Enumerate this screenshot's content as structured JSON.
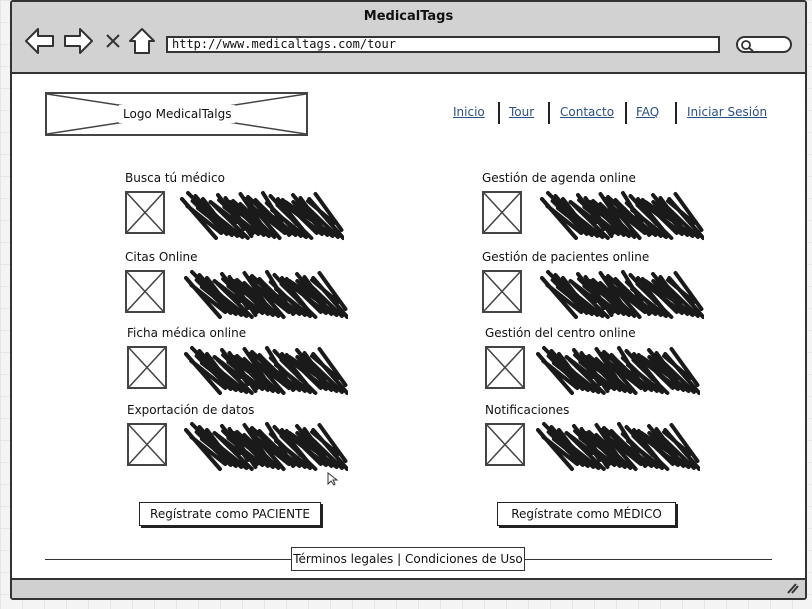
{
  "window": {
    "title": "MedicalTags"
  },
  "toolbar": {
    "url": "http://www.medicaltags.com/tour",
    "icons": [
      "back-arrow-icon",
      "forward-arrow-icon",
      "close-x-icon",
      "home-icon",
      "search-icon"
    ]
  },
  "header": {
    "logo_label": "Logo MedicalTalgs",
    "nav": [
      {
        "label": "Inicio"
      },
      {
        "label": "Tour"
      },
      {
        "label": "Contacto"
      },
      {
        "label": "FAQ"
      },
      {
        "label": "Iniciar Sesión"
      }
    ]
  },
  "features": {
    "left": [
      {
        "title": "Busca tú médico"
      },
      {
        "title": "Citas Online"
      },
      {
        "title": "Ficha médica online"
      },
      {
        "title": "Exportación de datos"
      }
    ],
    "right": [
      {
        "title": "Gestión de agenda online"
      },
      {
        "title": "Gestión de pacientes online"
      },
      {
        "title": "Gestión del centro online"
      },
      {
        "title": "Notificaciones"
      }
    ]
  },
  "buttons": {
    "patient": "Regístrate como PACIENTE",
    "doctor": "Regístrate como MÉDICO"
  },
  "footer": {
    "text": "Términos legales | Condiciones de Uso"
  }
}
